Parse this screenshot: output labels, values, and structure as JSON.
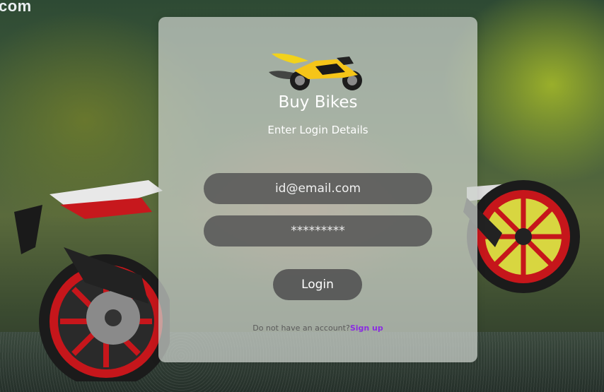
{
  "background": {
    "corner_text": "com"
  },
  "brand": {
    "logo_icon": "motorcycle-icon",
    "title": "Buy Bikes",
    "subtitle": "Enter Login Details"
  },
  "form": {
    "email_placeholder": "id@email.com",
    "password_placeholder": "*********",
    "login_label": "Login"
  },
  "footer": {
    "prompt": "Do not have an account?",
    "signup_label": "Sign up"
  },
  "colors": {
    "signup_link": "#8a2be2",
    "field_bg": "#585858",
    "card_bg": "#cdd2cd"
  }
}
